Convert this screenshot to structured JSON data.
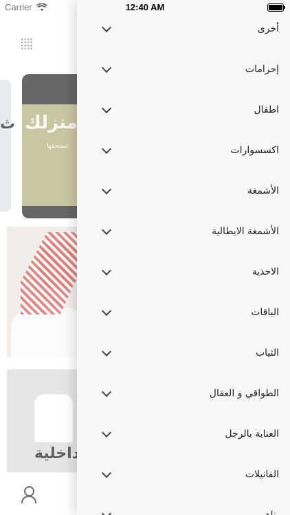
{
  "status_bar": {
    "carrier": "Carrier",
    "time": "12:40 AM"
  },
  "background": {
    "banner_word": "منزلك",
    "banner_sub": "تستحقها",
    "left_card_glyph": "ث",
    "under_word": "داخلية"
  },
  "drawer": {
    "items": [
      {
        "label": "أخرى"
      },
      {
        "label": "إحرامات"
      },
      {
        "label": "اطفال"
      },
      {
        "label": "اكسسوارات"
      },
      {
        "label": "الأشمغة"
      },
      {
        "label": "الأشمغة الايطالية"
      },
      {
        "label": "الاحذية"
      },
      {
        "label": "الباقات"
      },
      {
        "label": "الثياب"
      },
      {
        "label": "الطواقي و العقال"
      },
      {
        "label": "العناية بالرجل"
      },
      {
        "label": "الفانيلات"
      },
      {
        "label": "بناة"
      }
    ]
  }
}
